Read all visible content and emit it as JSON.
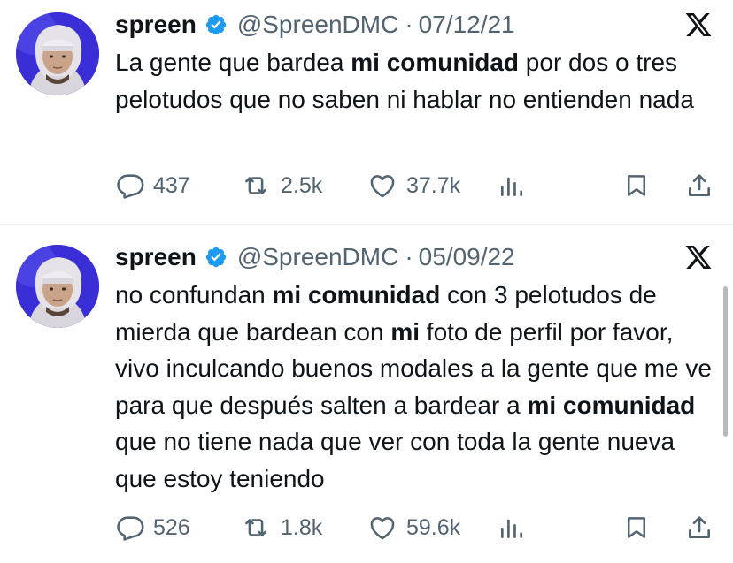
{
  "tweets": [
    {
      "name": "spreen",
      "handle": "@SpreenDMC",
      "separator": "·",
      "date": "07/12/21",
      "text_parts": [
        {
          "t": "La gente que bardea ",
          "bold": false
        },
        {
          "t": "mi comunidad",
          "bold": true
        },
        {
          "t": " por dos o tres pelotudos que no saben ni hablar no entienden nada",
          "bold": false
        }
      ],
      "replies": "437",
      "reposts": "2.5k",
      "likes": "37.7k"
    },
    {
      "name": "spreen",
      "handle": "@SpreenDMC",
      "separator": "·",
      "date": "05/09/22",
      "text_parts": [
        {
          "t": "no confundan ",
          "bold": false
        },
        {
          "t": "mi comunidad",
          "bold": true
        },
        {
          "t": " con 3 pelotudos de mierda que bardean con ",
          "bold": false
        },
        {
          "t": "mi",
          "bold": true
        },
        {
          "t": " foto de perfil por favor, vivo inculcando buenos modales a la gente que me ve para que después salten a bardear a ",
          "bold": false
        },
        {
          "t": "mi comunidad",
          "bold": true
        },
        {
          "t": " que no tiene nada que ver con toda la gente nueva que estoy teniendo",
          "bold": false
        }
      ],
      "replies": "526",
      "reposts": "1.8k",
      "likes": "59.6k"
    }
  ],
  "colors": {
    "text": "#0f1419",
    "secondary": "#536471",
    "verified": "#1d9bf0",
    "divider": "#eff3f4",
    "avatar_bg": "#3a2fd6"
  },
  "icons": [
    "verified-badge-icon",
    "x-logo-icon",
    "reply-icon",
    "repost-icon",
    "like-icon",
    "views-icon",
    "bookmark-icon",
    "share-icon"
  ]
}
